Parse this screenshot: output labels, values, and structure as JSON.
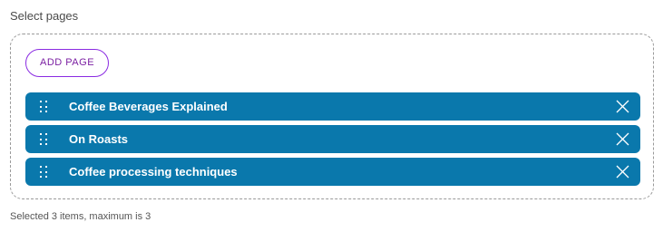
{
  "field_label": "Select pages",
  "add_button_label": "ADD PAGE",
  "items": [
    {
      "label": "Coffee Beverages Explained"
    },
    {
      "label": "On Roasts"
    },
    {
      "label": "Coffee processing techniques"
    }
  ],
  "footer_note": "Selected 3 items, maximum is 3",
  "colors": {
    "item_bg": "#0a78ac",
    "add_button_accent": "#8a2be2"
  },
  "icons": {
    "drag": "drag-handle-icon",
    "remove": "close-icon"
  }
}
